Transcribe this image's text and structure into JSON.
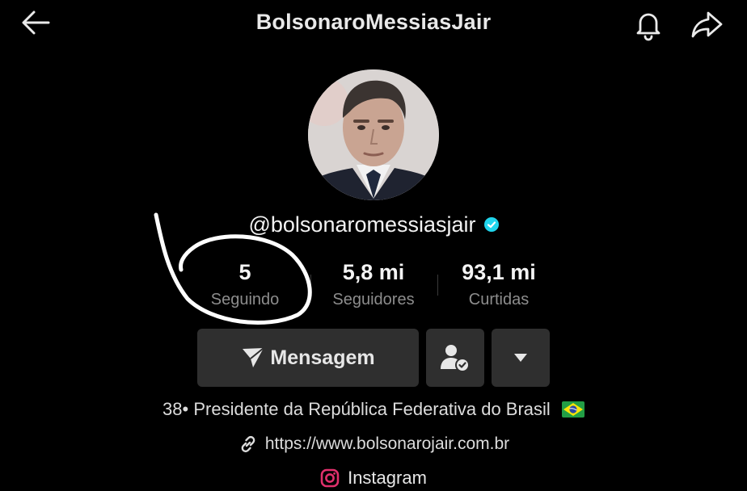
{
  "header": {
    "title": "BolsonaroMessiasJair",
    "back_icon": "arrow-left-icon",
    "bell_icon": "bell-icon",
    "share_icon": "share-icon"
  },
  "profile": {
    "handle": "@bolsonaromessiasjair",
    "verified_color": "#20d5ec"
  },
  "stats": [
    {
      "value": "5",
      "label": "Seguindo"
    },
    {
      "value": "5,8 mi",
      "label": "Seguidores"
    },
    {
      "value": "93,1 mi",
      "label": "Curtidas"
    }
  ],
  "actions": {
    "message_label": "Mensagem",
    "message_icon": "send-icon",
    "follow_icon": "user-check-icon",
    "more_icon": "caret-down-icon"
  },
  "bio": {
    "text": "38• Presidente da República Federativa do Brasil",
    "flag_icon": "brazil-flag-icon",
    "link": "https://www.bolsonarojair.com.br",
    "link_icon": "link-icon",
    "instagram_label": "Instagram",
    "instagram_icon": "instagram-icon",
    "instagram_color": "#e1306c"
  }
}
